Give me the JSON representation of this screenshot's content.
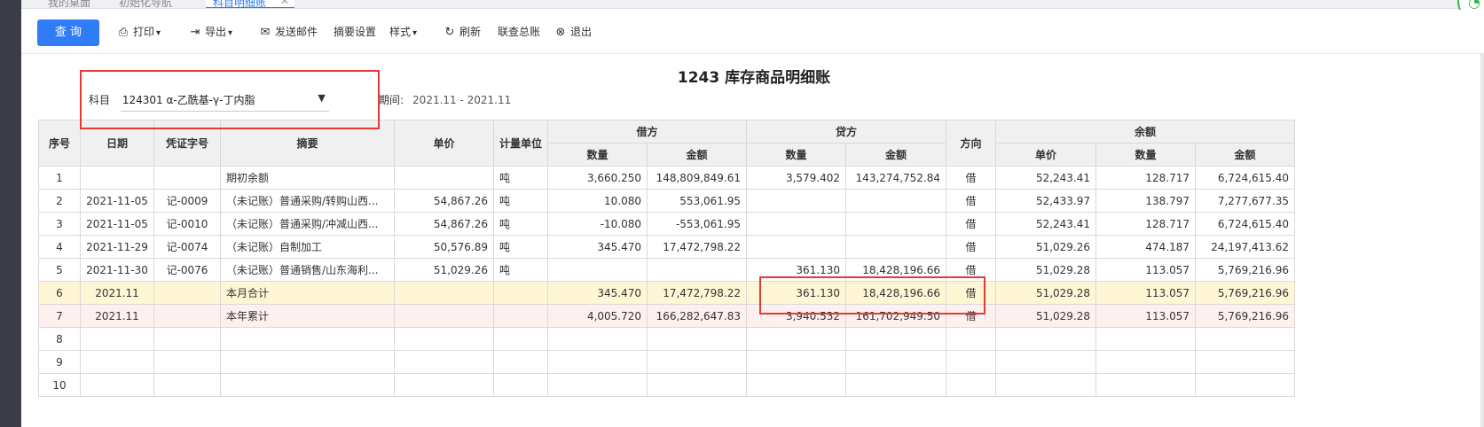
{
  "tabs": [
    {
      "label": "我的桌面"
    },
    {
      "label": "初始化导航"
    },
    {
      "label": "科目明细账",
      "close": "✕"
    }
  ],
  "toolbar": {
    "query": "查 询",
    "print": "打印",
    "export": "导出",
    "email": "发送邮件",
    "summary_settings": "摘要设置",
    "style": "样式",
    "refresh": "刷新",
    "ledger": "联查总账",
    "exit": "退出"
  },
  "report": {
    "title": "1243 库存商品明细账",
    "subject_label": "科目",
    "subject_value": "124301 α-乙酰基-γ-丁内脂",
    "period_label": "期间:",
    "period_value": "2021.11 - 2021.11"
  },
  "table": {
    "headers": {
      "seq": "序号",
      "date": "日期",
      "voucher": "凭证字号",
      "summary": "摘要",
      "unit_price": "单价",
      "unit": "计量单位",
      "debit": "借方",
      "credit": "贷方",
      "direction": "方向",
      "balance": "余额",
      "qty": "数量",
      "amount": "金额",
      "price": "单价"
    },
    "rows": [
      {
        "seq": "1",
        "date": "",
        "voucher": "",
        "summary": "期初余额",
        "price": "",
        "unit": "吨",
        "dq": "3,660.250",
        "da": "148,809,849.61",
        "cq": "3,579.402",
        "ca": "143,274,752.84",
        "dir": "借",
        "bp": "52,243.41",
        "bq": "128.717",
        "ba": "6,724,615.40"
      },
      {
        "seq": "2",
        "date": "2021-11-05",
        "voucher": "记-0009",
        "summary": "（未记账）普通采购/转购山西...",
        "price": "54,867.26",
        "unit": "吨",
        "dq": "10.080",
        "da": "553,061.95",
        "cq": "",
        "ca": "",
        "dir": "借",
        "bp": "52,433.97",
        "bq": "138.797",
        "ba": "7,277,677.35"
      },
      {
        "seq": "3",
        "date": "2021-11-05",
        "voucher": "记-0010",
        "summary": "（未记账）普通采购/冲减山西...",
        "price": "54,867.26",
        "unit": "吨",
        "dq": "-10.080",
        "da": "-553,061.95",
        "cq": "",
        "ca": "",
        "dir": "借",
        "bp": "52,243.41",
        "bq": "128.717",
        "ba": "6,724,615.40"
      },
      {
        "seq": "4",
        "date": "2021-11-29",
        "voucher": "记-0074",
        "summary": "（未记账）自制加工",
        "price": "50,576.89",
        "unit": "吨",
        "dq": "345.470",
        "da": "17,472,798.22",
        "cq": "",
        "ca": "",
        "dir": "借",
        "bp": "51,029.26",
        "bq": "474.187",
        "ba": "24,197,413.62"
      },
      {
        "seq": "5",
        "date": "2021-11-30",
        "voucher": "记-0076",
        "summary": "（未记账）普通销售/山东海利...",
        "price": "51,029.26",
        "unit": "吨",
        "dq": "",
        "da": "",
        "cq": "361.130",
        "ca": "18,428,196.66",
        "dir": "借",
        "bp": "51,029.28",
        "bq": "113.057",
        "ba": "5,769,216.96"
      },
      {
        "seq": "6",
        "date": "2021.11",
        "voucher": "",
        "summary": "本月合计",
        "price": "",
        "unit": "",
        "dq": "345.470",
        "da": "17,472,798.22",
        "cq": "361.130",
        "ca": "18,428,196.66",
        "dir": "借",
        "bp": "51,029.28",
        "bq": "113.057",
        "ba": "5,769,216.96"
      },
      {
        "seq": "7",
        "date": "2021.11",
        "voucher": "",
        "summary": "本年累计",
        "price": "",
        "unit": "",
        "dq": "4,005.720",
        "da": "166,282,647.83",
        "cq": "3,940.532",
        "ca": "161,702,949.50",
        "dir": "借",
        "bp": "51,029.28",
        "bq": "113.057",
        "ba": "5,769,216.96"
      },
      {
        "seq": "8"
      },
      {
        "seq": "9"
      },
      {
        "seq": "10"
      }
    ]
  }
}
